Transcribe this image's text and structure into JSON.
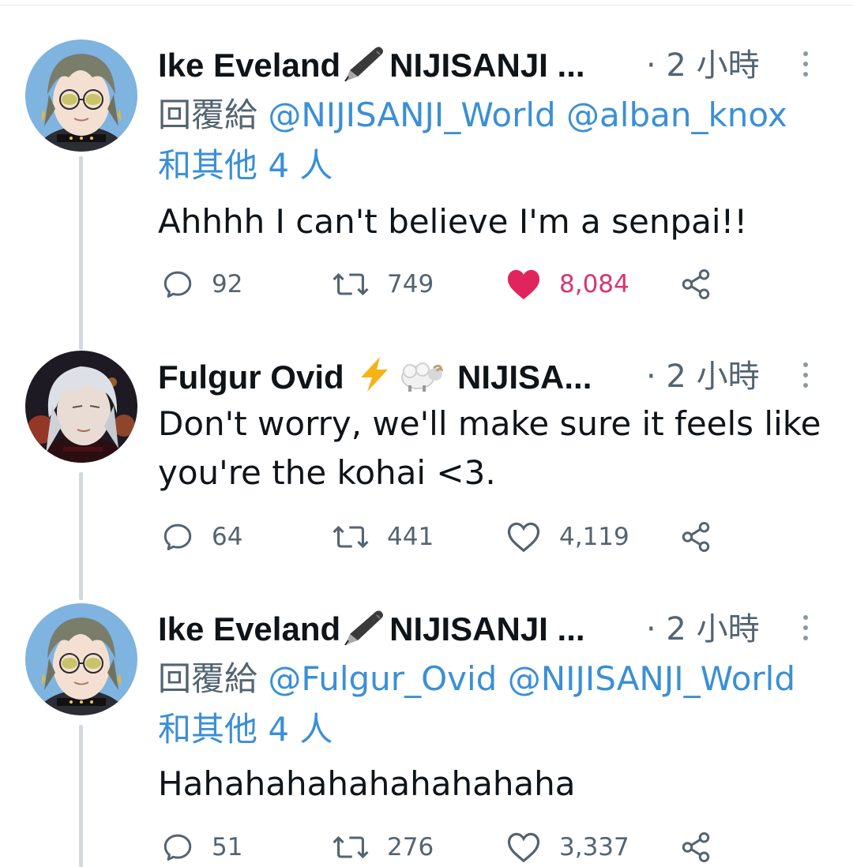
{
  "tweets": [
    {
      "display_name": "Ike Eveland",
      "name_suffix": "NIJISANJI ...",
      "name_emoji": "pen-nib-icon",
      "time": "· 2 小時",
      "reply_prefix": "回覆給",
      "mentions": [
        "@NIJISANJI_World",
        "@alban_knox"
      ],
      "others": "和其他 4 人",
      "text": "Ahhhh I can't believe I'm a senpai!!",
      "replies": "92",
      "retweets": "749",
      "likes": "8,084",
      "liked": true
    },
    {
      "display_name": "Fulgur Ovid",
      "name_suffix": "NIJISA...",
      "name_emoji": "lightning-and-sheep-icons",
      "time": "· 2 小時",
      "text_line1": "Don't worry, we'll make sure it feels like",
      "text_line2": "you're the kohai <3.",
      "replies": "64",
      "retweets": "441",
      "likes": "4,119",
      "liked": false
    },
    {
      "display_name": "Ike Eveland",
      "name_suffix": "NIJISANJI ...",
      "name_emoji": "pen-nib-icon",
      "time": "· 2 小時",
      "reply_prefix": "回覆給",
      "mentions": [
        "@Fulgur_Ovid",
        "@NIJISANJI_World"
      ],
      "others": "和其他 4 人",
      "text": "Hahahahahahahahahaha",
      "replies": "51",
      "retweets": "276",
      "likes": "3,337",
      "liked": false
    }
  ],
  "colors": {
    "link": "#3b8fd6",
    "secondary_text": "#536471",
    "like_active": "#e0245e",
    "thread_line": "#cfd9de"
  }
}
